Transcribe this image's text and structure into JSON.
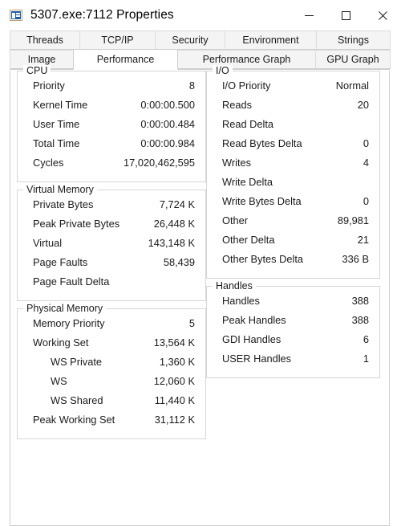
{
  "window": {
    "title": "5307.exe:7112 Properties",
    "icon": "process-properties-icon",
    "controls": {
      "minimize": "minimize-icon",
      "maximize": "maximize-icon",
      "close": "close-icon"
    }
  },
  "tabs": {
    "row1": [
      {
        "label": "Threads",
        "selected": false
      },
      {
        "label": "TCP/IP",
        "selected": false
      },
      {
        "label": "Security",
        "selected": false
      },
      {
        "label": "Environment",
        "selected": false
      },
      {
        "label": "Strings",
        "selected": false
      }
    ],
    "row2": [
      {
        "label": "Image",
        "selected": false
      },
      {
        "label": "Performance",
        "selected": true
      },
      {
        "label": "Performance Graph",
        "selected": false
      },
      {
        "label": "GPU Graph",
        "selected": false
      }
    ]
  },
  "groups": {
    "cpu": {
      "title": "CPU",
      "rows": [
        {
          "label": "Priority",
          "value": "8",
          "indent": false
        },
        {
          "label": "Kernel Time",
          "value": "0:00:00.500",
          "indent": false
        },
        {
          "label": "User Time",
          "value": "0:00:00.484",
          "indent": false
        },
        {
          "label": "Total Time",
          "value": "0:00:00.984",
          "indent": false
        },
        {
          "label": "Cycles",
          "value": "17,020,462,595",
          "indent": false
        }
      ]
    },
    "virtual_memory": {
      "title": "Virtual Memory",
      "rows": [
        {
          "label": "Private Bytes",
          "value": "7,724 K",
          "indent": false
        },
        {
          "label": "Peak Private Bytes",
          "value": "26,448 K",
          "indent": false
        },
        {
          "label": "Virtual",
          "value": "143,148 K",
          "indent": false
        },
        {
          "label": "Page Faults",
          "value": "58,439",
          "indent": false
        },
        {
          "label": "Page Fault Delta",
          "value": "",
          "indent": false
        }
      ]
    },
    "physical_memory": {
      "title": "Physical Memory",
      "rows": [
        {
          "label": "Memory Priority",
          "value": "5",
          "indent": false
        },
        {
          "label": "Working Set",
          "value": "13,564 K",
          "indent": false
        },
        {
          "label": "WS Private",
          "value": "1,360 K",
          "indent": true
        },
        {
          "label": "WS",
          "value": "12,060 K",
          "indent": true
        },
        {
          "label": "WS Shared",
          "value": "11,440 K",
          "indent": true
        },
        {
          "label": "Peak Working Set",
          "value": "31,112 K",
          "indent": false
        }
      ]
    },
    "io": {
      "title": "I/O",
      "rows": [
        {
          "label": "I/O Priority",
          "value": "Normal",
          "indent": false
        },
        {
          "label": "Reads",
          "value": "20",
          "indent": false
        },
        {
          "label": "Read Delta",
          "value": "",
          "indent": false
        },
        {
          "label": "Read Bytes Delta",
          "value": "0",
          "indent": false
        },
        {
          "label": "Writes",
          "value": "4",
          "indent": false
        },
        {
          "label": "Write Delta",
          "value": "",
          "indent": false
        },
        {
          "label": "Write Bytes Delta",
          "value": "0",
          "indent": false
        },
        {
          "label": "Other",
          "value": "89,981",
          "indent": false
        },
        {
          "label": "Other Delta",
          "value": "21",
          "indent": false
        },
        {
          "label": "Other Bytes Delta",
          "value": "336 B",
          "indent": false
        }
      ]
    },
    "handles": {
      "title": "Handles",
      "rows": [
        {
          "label": "Handles",
          "value": "388",
          "indent": false
        },
        {
          "label": "Peak Handles",
          "value": "388",
          "indent": false
        },
        {
          "label": "GDI Handles",
          "value": "6",
          "indent": false
        },
        {
          "label": "USER Handles",
          "value": "1",
          "indent": false
        }
      ]
    }
  },
  "colors": {
    "window_bg": "#ffffff",
    "desktop_bg": "#f0f0f0",
    "border": "#cfcfcf",
    "group_border": "#d6d6d6",
    "tab_inactive_bg": "#f4f4f4",
    "text": "#1a1a1a",
    "icon_blue": "#1b5fa8"
  }
}
